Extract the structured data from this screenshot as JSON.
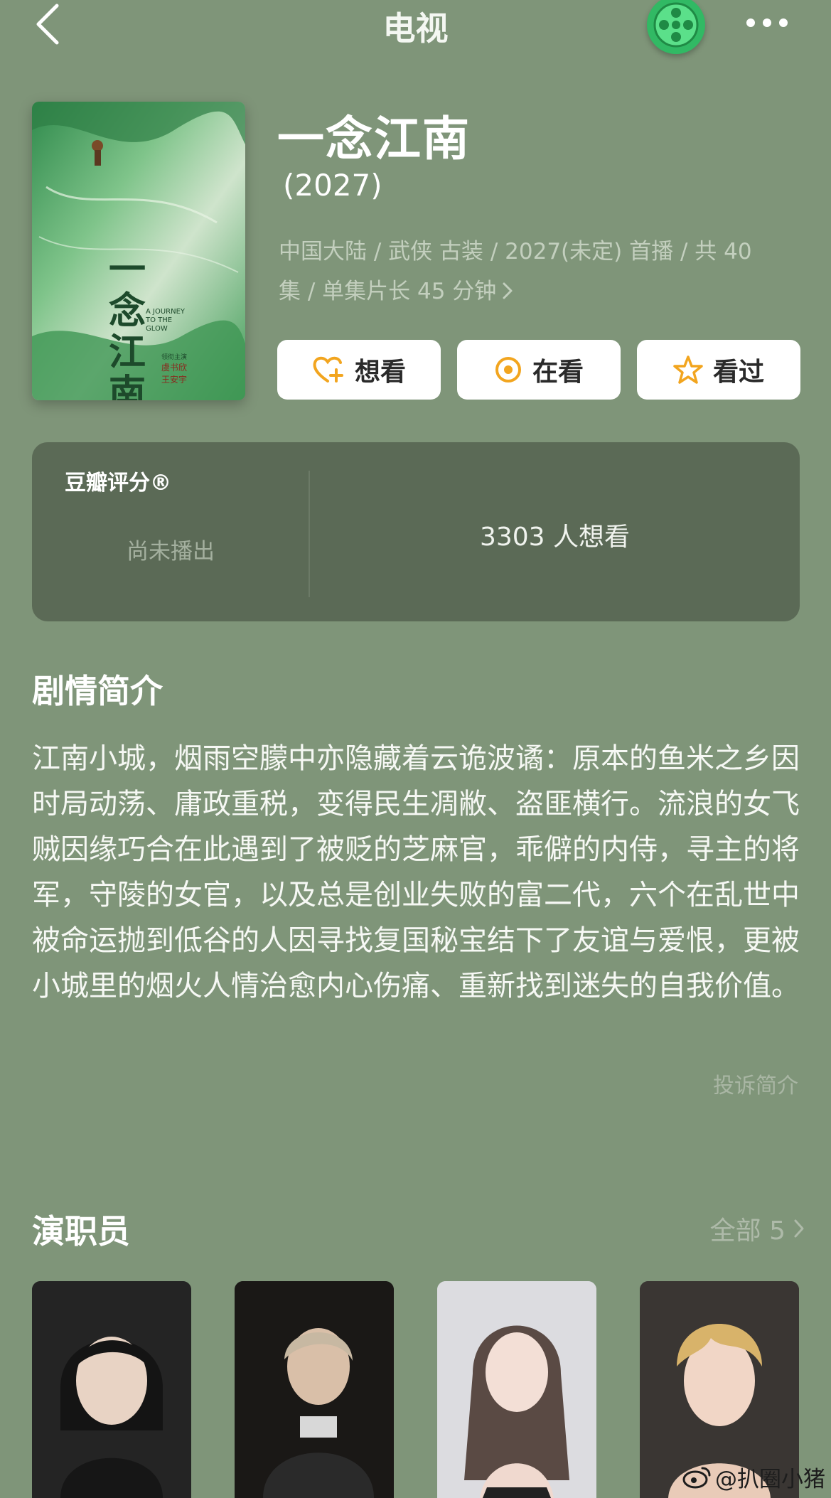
{
  "header": {
    "title": "电视",
    "back_icon": "chevron-left-icon",
    "logo_icon": "film-reel-icon",
    "more_icon": "ellipsis-icon"
  },
  "show": {
    "title": "一念江南",
    "year": "(2027)",
    "meta_line1": "中国大陆 / 武侠 古装 / 2027(未定) 首播 / 共 40",
    "meta_line2": "集 / 单集片长 45 分钟",
    "poster": {
      "title_text": "一念江南",
      "subtitle_en": "A JOURNEY TO THE GLOW",
      "credit_lines": [
        "领衔主演",
        "虞书欣",
        "王安宇"
      ]
    }
  },
  "actions": [
    {
      "label": "想看",
      "icon": "heart-plus-icon"
    },
    {
      "label": "在看",
      "icon": "target-circle-icon"
    },
    {
      "label": "看过",
      "icon": "star-icon"
    }
  ],
  "rating": {
    "label": "豆瓣评分®",
    "status": "尚未播出",
    "wish_count": "3303 人想看"
  },
  "synopsis": {
    "heading": "剧情简介",
    "text": "江南小城，烟雨空朦中亦隐藏着云诡波谲：原本的鱼米之乡因时局动荡、庸政重税，变得民生凋敝、盗匪横行。流浪的女飞贼因缘巧合在此遇到了被贬的芝麻官，乖僻的内侍，寻主的将军，守陵的女官，以及总是创业失败的富二代，六个在乱世中被命运抛到低谷的人因寻找复国秘宝结下了友谊与爱恨，更被小城里的烟火人情治愈内心伤痛、重新找到迷失的自我价值。",
    "report_label": "投诉简介"
  },
  "cast": {
    "heading": "演职员",
    "all_label": "全部 5",
    "members": [
      {
        "name": "cast-1",
        "bg": "#2a2a2a"
      },
      {
        "name": "cast-2",
        "bg": "#1c1a18"
      },
      {
        "name": "cast-3",
        "bg": "#d9d9dd"
      },
      {
        "name": "cast-4",
        "bg": "#3a3633"
      }
    ]
  },
  "watermark": {
    "text": "@扒圈小猪",
    "icon": "weibo-icon"
  },
  "colors": {
    "background": "#7f9579",
    "card": "#5b6a56",
    "accent_orange": "#f2a51f",
    "logo_green": "#31b964"
  }
}
